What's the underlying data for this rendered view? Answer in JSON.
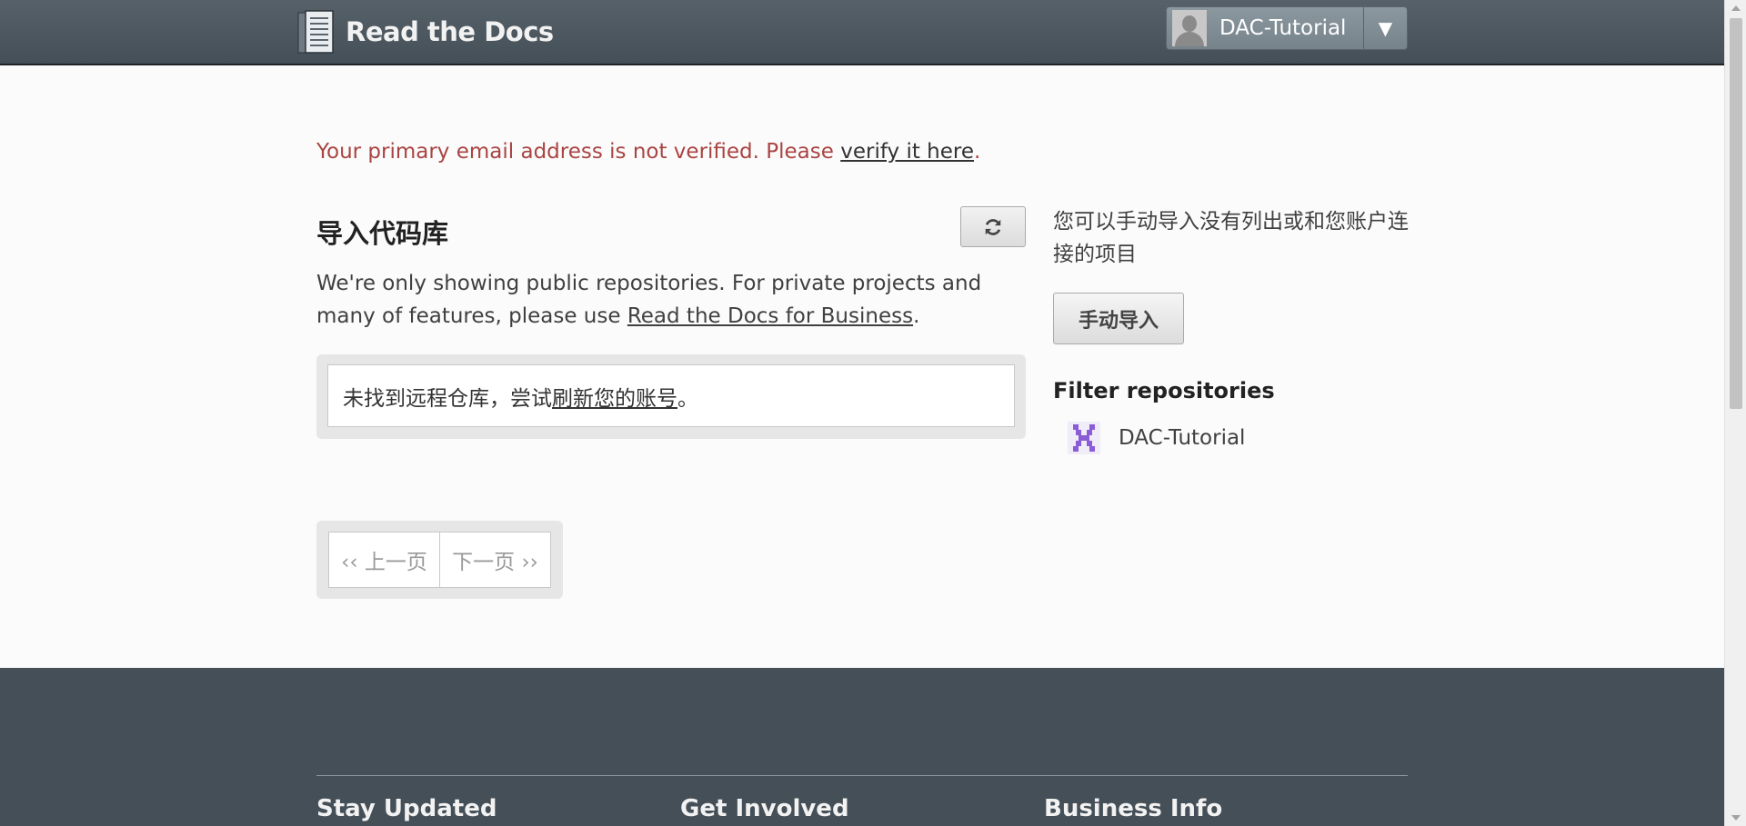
{
  "header": {
    "brand": "Read the Docs",
    "logo_icon": "book-icon",
    "user_name": "DAC-Tutorial",
    "dropdown_arrow": "▼"
  },
  "alert": {
    "text_before": "Your primary email address is not verified. Please ",
    "link_text": "verify it here",
    "text_after": "."
  },
  "import": {
    "title": "导入代码库",
    "refresh_icon": "refresh-icon",
    "desc_before": "We're only showing public repositories. For private projects and many of features, please use ",
    "desc_link": "Read the Docs for Business",
    "desc_after": ".",
    "empty_before": "未找到远程仓库，尝试 ",
    "empty_link": "刷新您的账号",
    "empty_after": "。"
  },
  "pagination": {
    "prev": "‹‹ 上一页",
    "next": "下一页 ››"
  },
  "sidebar": {
    "manual_text": "您可以手动导入没有列出或和您账户连接的项目",
    "manual_button": "手动导入",
    "filter_title": "Filter repositories",
    "filters": [
      {
        "label": "DAC-Tutorial",
        "icon": "org-avatar-icon"
      }
    ]
  },
  "footer": {
    "columns": [
      "Stay Updated",
      "Get Involved",
      "Business Info"
    ]
  },
  "colors": {
    "header_bg": "#4b565e",
    "alert_text": "#a94442",
    "footer_bg": "#444f57",
    "avatar_accent": "#8a5cd6"
  }
}
